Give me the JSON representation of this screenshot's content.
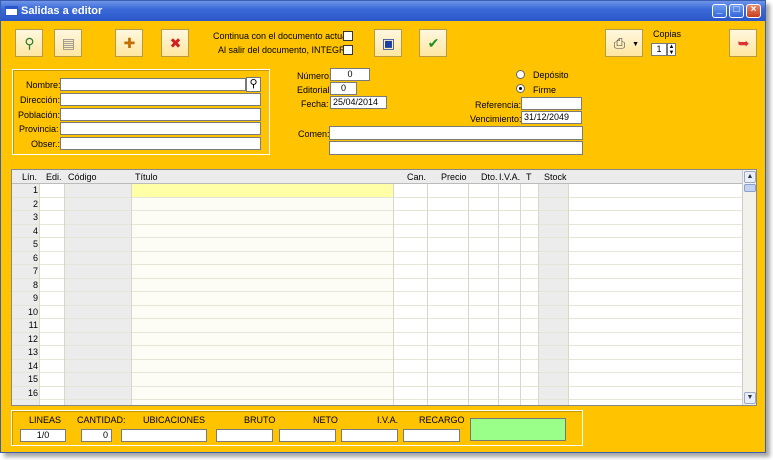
{
  "window": {
    "title": "Salidas a editor"
  },
  "toolbar": {
    "chk_continua": "Continua con el documento actual",
    "chk_integra": "Al salir del documento, INTEGRA",
    "copias_label": "Copias",
    "copias_value": "1"
  },
  "cliente": {
    "nombre_label": "Nombre:",
    "direccion_label": "Dirección:",
    "poblacion_label": "Población:",
    "provincia_label": "Provincia:",
    "obser_label": "Obser.:"
  },
  "doc": {
    "numero_label": "Número:",
    "numero_value": "0",
    "editorial_label": "Editorial:",
    "editorial_value": "0",
    "fecha_label": "Fecha:",
    "fecha_value": "25/04/2014",
    "comen_label": "Comen:",
    "deposito_label": "Depósito",
    "firme_label": "Firme",
    "referencia_label": "Referencia:",
    "vencimiento_label": "Vencimiento:",
    "vencimiento_value": "31/12/2049"
  },
  "grid": {
    "headers": [
      "Lín.",
      "Edi.",
      "Código",
      "Título",
      "Can.",
      "Precio",
      "Dto.",
      "I.V.A.",
      "T",
      "Stock"
    ],
    "rows": [
      "1",
      "2",
      "3",
      "4",
      "5",
      "6",
      "7",
      "8",
      "9",
      "10",
      "11",
      "12",
      "13",
      "14",
      "15",
      "16"
    ]
  },
  "totals": {
    "lineas_label": "LINEAS",
    "lineas_value": "1/0",
    "cantidad_label": "CANTIDAD:",
    "cantidad_value": "0",
    "ubicaciones_label": "UBICACIONES",
    "bruto_label": "BRUTO",
    "neto_label": "NETO",
    "iva_label": "I.V.A.",
    "recargo_label": "RECARGO"
  },
  "colors": {
    "background": "#FFC300",
    "selected_cell": "#FFFFA8",
    "total_box": "#99FF88"
  }
}
